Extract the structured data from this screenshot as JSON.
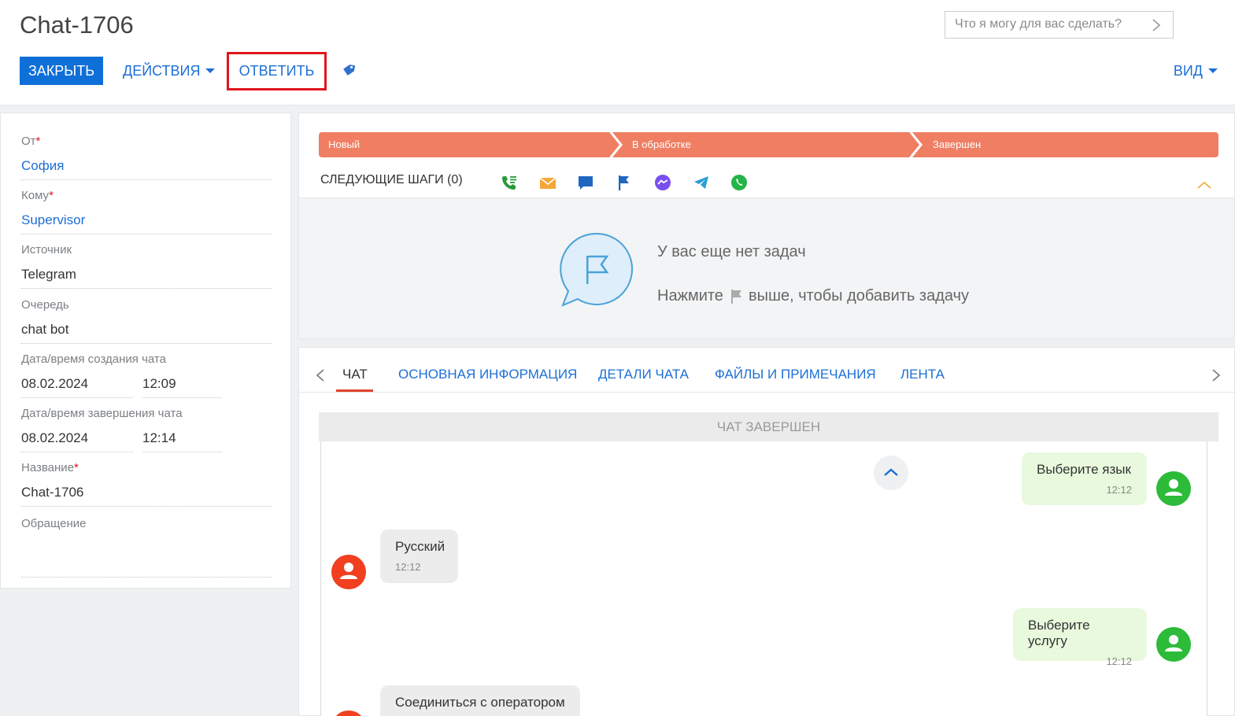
{
  "header": {
    "title": "Chat-1706",
    "search_placeholder": "Что я могу для вас сделать?",
    "close_label": "ЗАКРЫТЬ",
    "actions_label": "ДЕЙСТВИЯ",
    "reply_label": "ОТВЕТИТЬ",
    "view_label": "ВИД",
    "tag_icon": "tag-icon"
  },
  "fields": {
    "from": {
      "label": "От",
      "value": "София"
    },
    "to": {
      "label": "Кому",
      "value": "Supervisor"
    },
    "source": {
      "label": "Источник",
      "value": "Telegram"
    },
    "queue": {
      "label": "Очередь",
      "value": "chat bot"
    },
    "created": {
      "label": "Дата/время создания чата",
      "date": "08.02.2024",
      "time": "12:09"
    },
    "finished": {
      "label": "Дата/время завершения чата",
      "date": "08.02.2024",
      "time": "12:14"
    },
    "name": {
      "label": "Название",
      "value": "Chat-1706"
    },
    "request": {
      "label": "Обращение",
      "value": ""
    }
  },
  "stages": [
    {
      "label": "Новый"
    },
    {
      "label": "В обработке"
    },
    {
      "label": "Завершен"
    }
  ],
  "stage_color": "#f07e62",
  "next_steps": {
    "label": "СЛЕДУЮЩИЕ ШАГИ (0)",
    "icons": [
      "call-icon",
      "email-icon",
      "chat-icon",
      "flag-icon",
      "messenger-icon",
      "telegram-icon",
      "whatsapp-icon"
    ],
    "empty_title": "У вас еще нет задач",
    "empty_hint_before": "Нажмите",
    "empty_hint_after": "выше, чтобы добавить задачу"
  },
  "tabs": [
    {
      "label": "ЧАТ",
      "active": true
    },
    {
      "label": "ОСНОВНАЯ ИНФОРМАЦИЯ",
      "active": false
    },
    {
      "label": "ДЕТАЛИ ЧАТА",
      "active": false
    },
    {
      "label": "ФАЙЛЫ И ПРИМЕЧАНИЯ",
      "active": false
    },
    {
      "label": "ЛЕНТА",
      "active": false
    }
  ],
  "chat": {
    "status": "ЧАТ ЗАВЕРШЕН",
    "messages": [
      {
        "direction": "out",
        "text": "Выберите язык",
        "time": "12:12"
      },
      {
        "direction": "in",
        "text": "Русский",
        "time": "12:12"
      },
      {
        "direction": "out",
        "text": "Выберите услугу",
        "time": "12:12"
      },
      {
        "direction": "in",
        "text": "Соединиться с оператором",
        "time": ""
      }
    ]
  },
  "colors": {
    "accent": "#0f6fd8",
    "link": "#1d6fd6",
    "highlight": "#e0151b",
    "outgoing_bubble": "#e8f9dd",
    "incoming_bubble": "#ececec",
    "bot_avatar": "#2dbb3a",
    "user_avatar": "#f0401f"
  }
}
